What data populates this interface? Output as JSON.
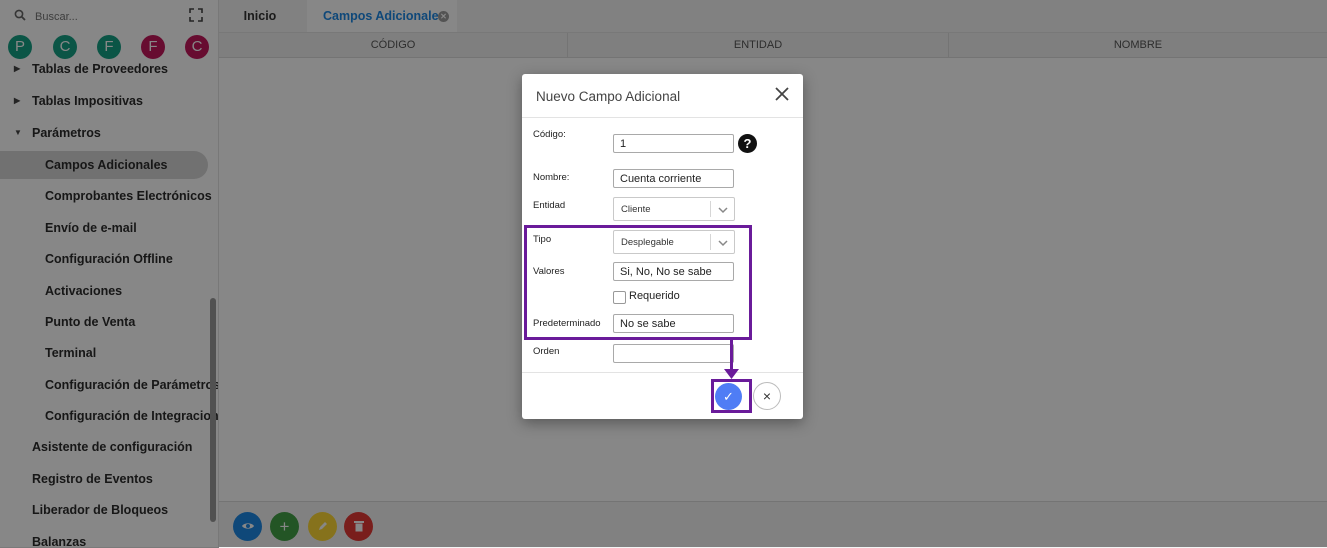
{
  "sidebar": {
    "search_placeholder": "Buscar...",
    "avatars": [
      {
        "letter": "P",
        "color": "#16a085"
      },
      {
        "letter": "C",
        "color": "#16a085"
      },
      {
        "letter": "F",
        "color": "#16a085"
      },
      {
        "letter": "F",
        "color": "#c2185b"
      },
      {
        "letter": "C",
        "color": "#c2185b"
      }
    ],
    "items": [
      {
        "label": "Tablas de Proveedores"
      },
      {
        "label": "Tablas Impositivas"
      },
      {
        "label": "Parámetros"
      },
      {
        "label": "Campos Adicionales"
      },
      {
        "label": "Comprobantes Electrónicos"
      },
      {
        "label": "Envío de e-mail"
      },
      {
        "label": "Configuración Offline"
      },
      {
        "label": "Activaciones"
      },
      {
        "label": "Punto de Venta"
      },
      {
        "label": "Terminal"
      },
      {
        "label": "Configuración de Parámetros"
      },
      {
        "label": "Configuración de Integracione"
      },
      {
        "label": "Asistente de configuración"
      },
      {
        "label": "Registro de Eventos"
      },
      {
        "label": "Liberador de Bloqueos"
      },
      {
        "label": "Balanzas"
      }
    ]
  },
  "tabs": [
    {
      "label": "Inicio"
    },
    {
      "label": "Campos Adicionales"
    }
  ],
  "grid": {
    "columns": [
      "CÓDIGO",
      "ENTIDAD",
      "NOMBRE"
    ]
  },
  "toolbar": {
    "buttons": [
      {
        "icon": "eye-icon",
        "color": "#1e88e5"
      },
      {
        "icon": "plus-icon",
        "color": "#43a047"
      },
      {
        "icon": "pencil-icon",
        "color": "#fdd835"
      },
      {
        "icon": "trash-icon",
        "color": "#e53935"
      }
    ]
  },
  "modal": {
    "title": "Nuevo Campo Adicional",
    "fields": {
      "codigo": {
        "label": "Código:",
        "value": "1"
      },
      "nombre": {
        "label": "Nombre:",
        "value": "Cuenta corriente"
      },
      "entidad": {
        "label": "Entidad",
        "value": "Cliente"
      },
      "tipo": {
        "label": "Tipo",
        "value": "Desplegable"
      },
      "valores": {
        "label": "Valores",
        "value": "Si, No, No se sabe"
      },
      "requerido": {
        "label": "Requerido",
        "checked": false
      },
      "predeterminado": {
        "label": "Predeterminado",
        "value": "No se sabe"
      },
      "orden": {
        "label": "Orden",
        "value": ""
      }
    },
    "help_glyph": "?",
    "confirm_glyph": "✓",
    "cancel_glyph": "×"
  },
  "colors": {
    "accent_blue": "#1e88e5",
    "highlight_purple": "#6a1b9a",
    "confirm_button": "#4f7df5"
  }
}
